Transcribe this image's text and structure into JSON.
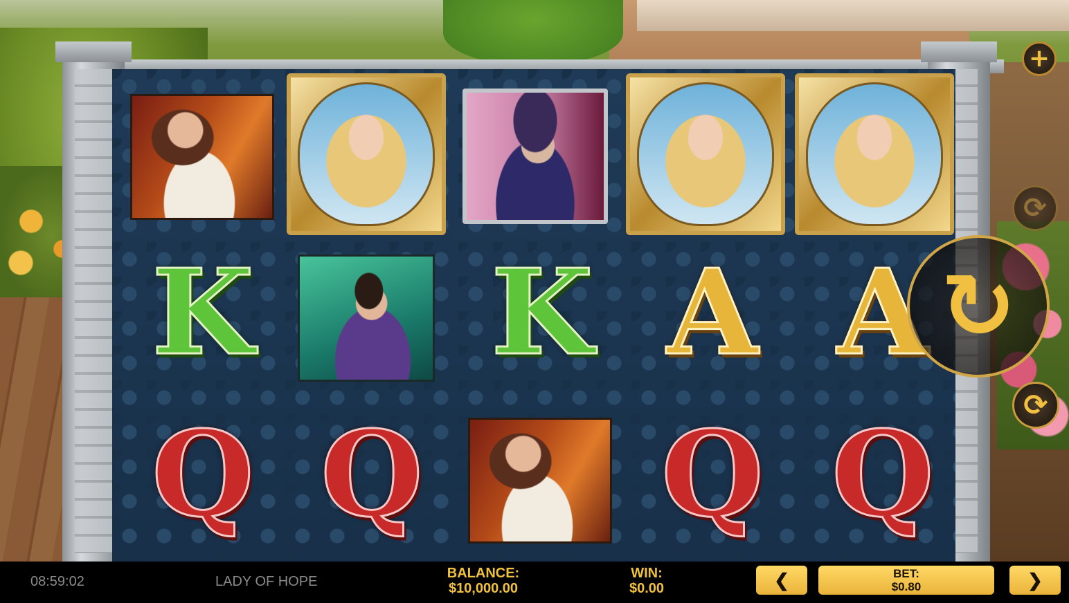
{
  "game": {
    "title": "LADY OF HOPE"
  },
  "status": {
    "clock": "08:59:02",
    "balance_label": "BALANCE:",
    "balance_value": "$10,000.00",
    "win_label": "WIN:",
    "win_value": "$0.00",
    "bet_label": "BET:",
    "bet_value": "$0.80"
  },
  "controls": {
    "bet_decrease": "❮",
    "bet_increase": "❯",
    "plus": "+",
    "spin": "↻",
    "replay": "⟳",
    "autoplay": "⟳"
  },
  "reels": {
    "rows": [
      [
        "lady-red",
        "lady-gold",
        "lord",
        "lady-gold",
        "lady-gold"
      ],
      [
        "K",
        "young-man",
        "K",
        "A",
        "A"
      ],
      [
        "Q",
        "Q",
        "lady-red",
        "Q",
        "Q"
      ]
    ]
  },
  "letters": {
    "k": "K",
    "a": "A",
    "q": "Q"
  },
  "colors": {
    "accent": "#f1c23e",
    "button": "#ffd965",
    "reel_bg": "#1d3550"
  }
}
